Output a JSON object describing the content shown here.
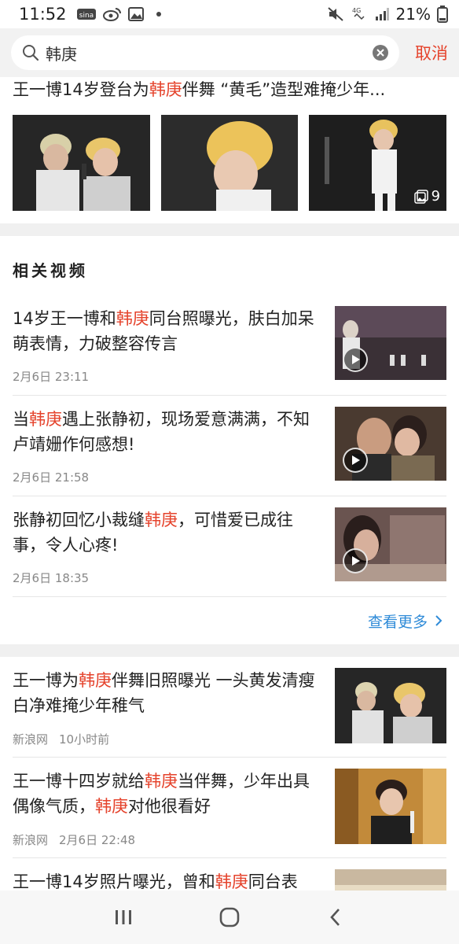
{
  "status_bar": {
    "time": "11:52",
    "network": "4G",
    "battery": "21%"
  },
  "search": {
    "query": "韩庚",
    "cancel_label": "取消"
  },
  "top_article": {
    "title_pre": "王一博14岁登台为",
    "title_hl": "韩庚",
    "title_post": "伴舞 “黄毛”造型难掩少年...",
    "image_count": "9"
  },
  "related_videos": {
    "section_title": "相关视频",
    "items": [
      {
        "pre": "14岁王一博和",
        "hl": "韩庚",
        "post": "同台照曝光，肤白加呆萌表情，力破整容传言",
        "date": "2月6日 23:11"
      },
      {
        "pre": "当",
        "hl": "韩庚",
        "post": "遇上张静初，现场爱意满满，不知卢靖姗作何感想!",
        "date": "2月6日 21:58"
      },
      {
        "pre": "张静初回忆小裁缝",
        "hl": "韩庚",
        "post": "，可惜爱已成往事，令人心疼!",
        "date": "2月6日 18:35"
      }
    ],
    "more_label": "查看更多"
  },
  "news": [
    {
      "pre": "王一博为",
      "hl": "韩庚",
      "post": "伴舞旧照曝光 一头黄发清瘦白净难掩少年稚气",
      "source": "新浪网",
      "time": "10小时前"
    },
    {
      "pre": "王一博十四岁就给",
      "hl": "韩庚",
      "post": "当伴舞，少年出具偶像气质，",
      "hl2": "韩庚",
      "post2": "对他很看好",
      "source": "新浪网",
      "time": "2月6日 22:48"
    },
    {
      "pre": "王一博14岁照片曝光，曾和",
      "hl": "韩庚",
      "post": "同台表演，留着黄发在一旁伴舞！",
      "source": "",
      "time": ""
    }
  ],
  "colors": {
    "highlight": "#e5432c",
    "link": "#2f8bd8"
  }
}
